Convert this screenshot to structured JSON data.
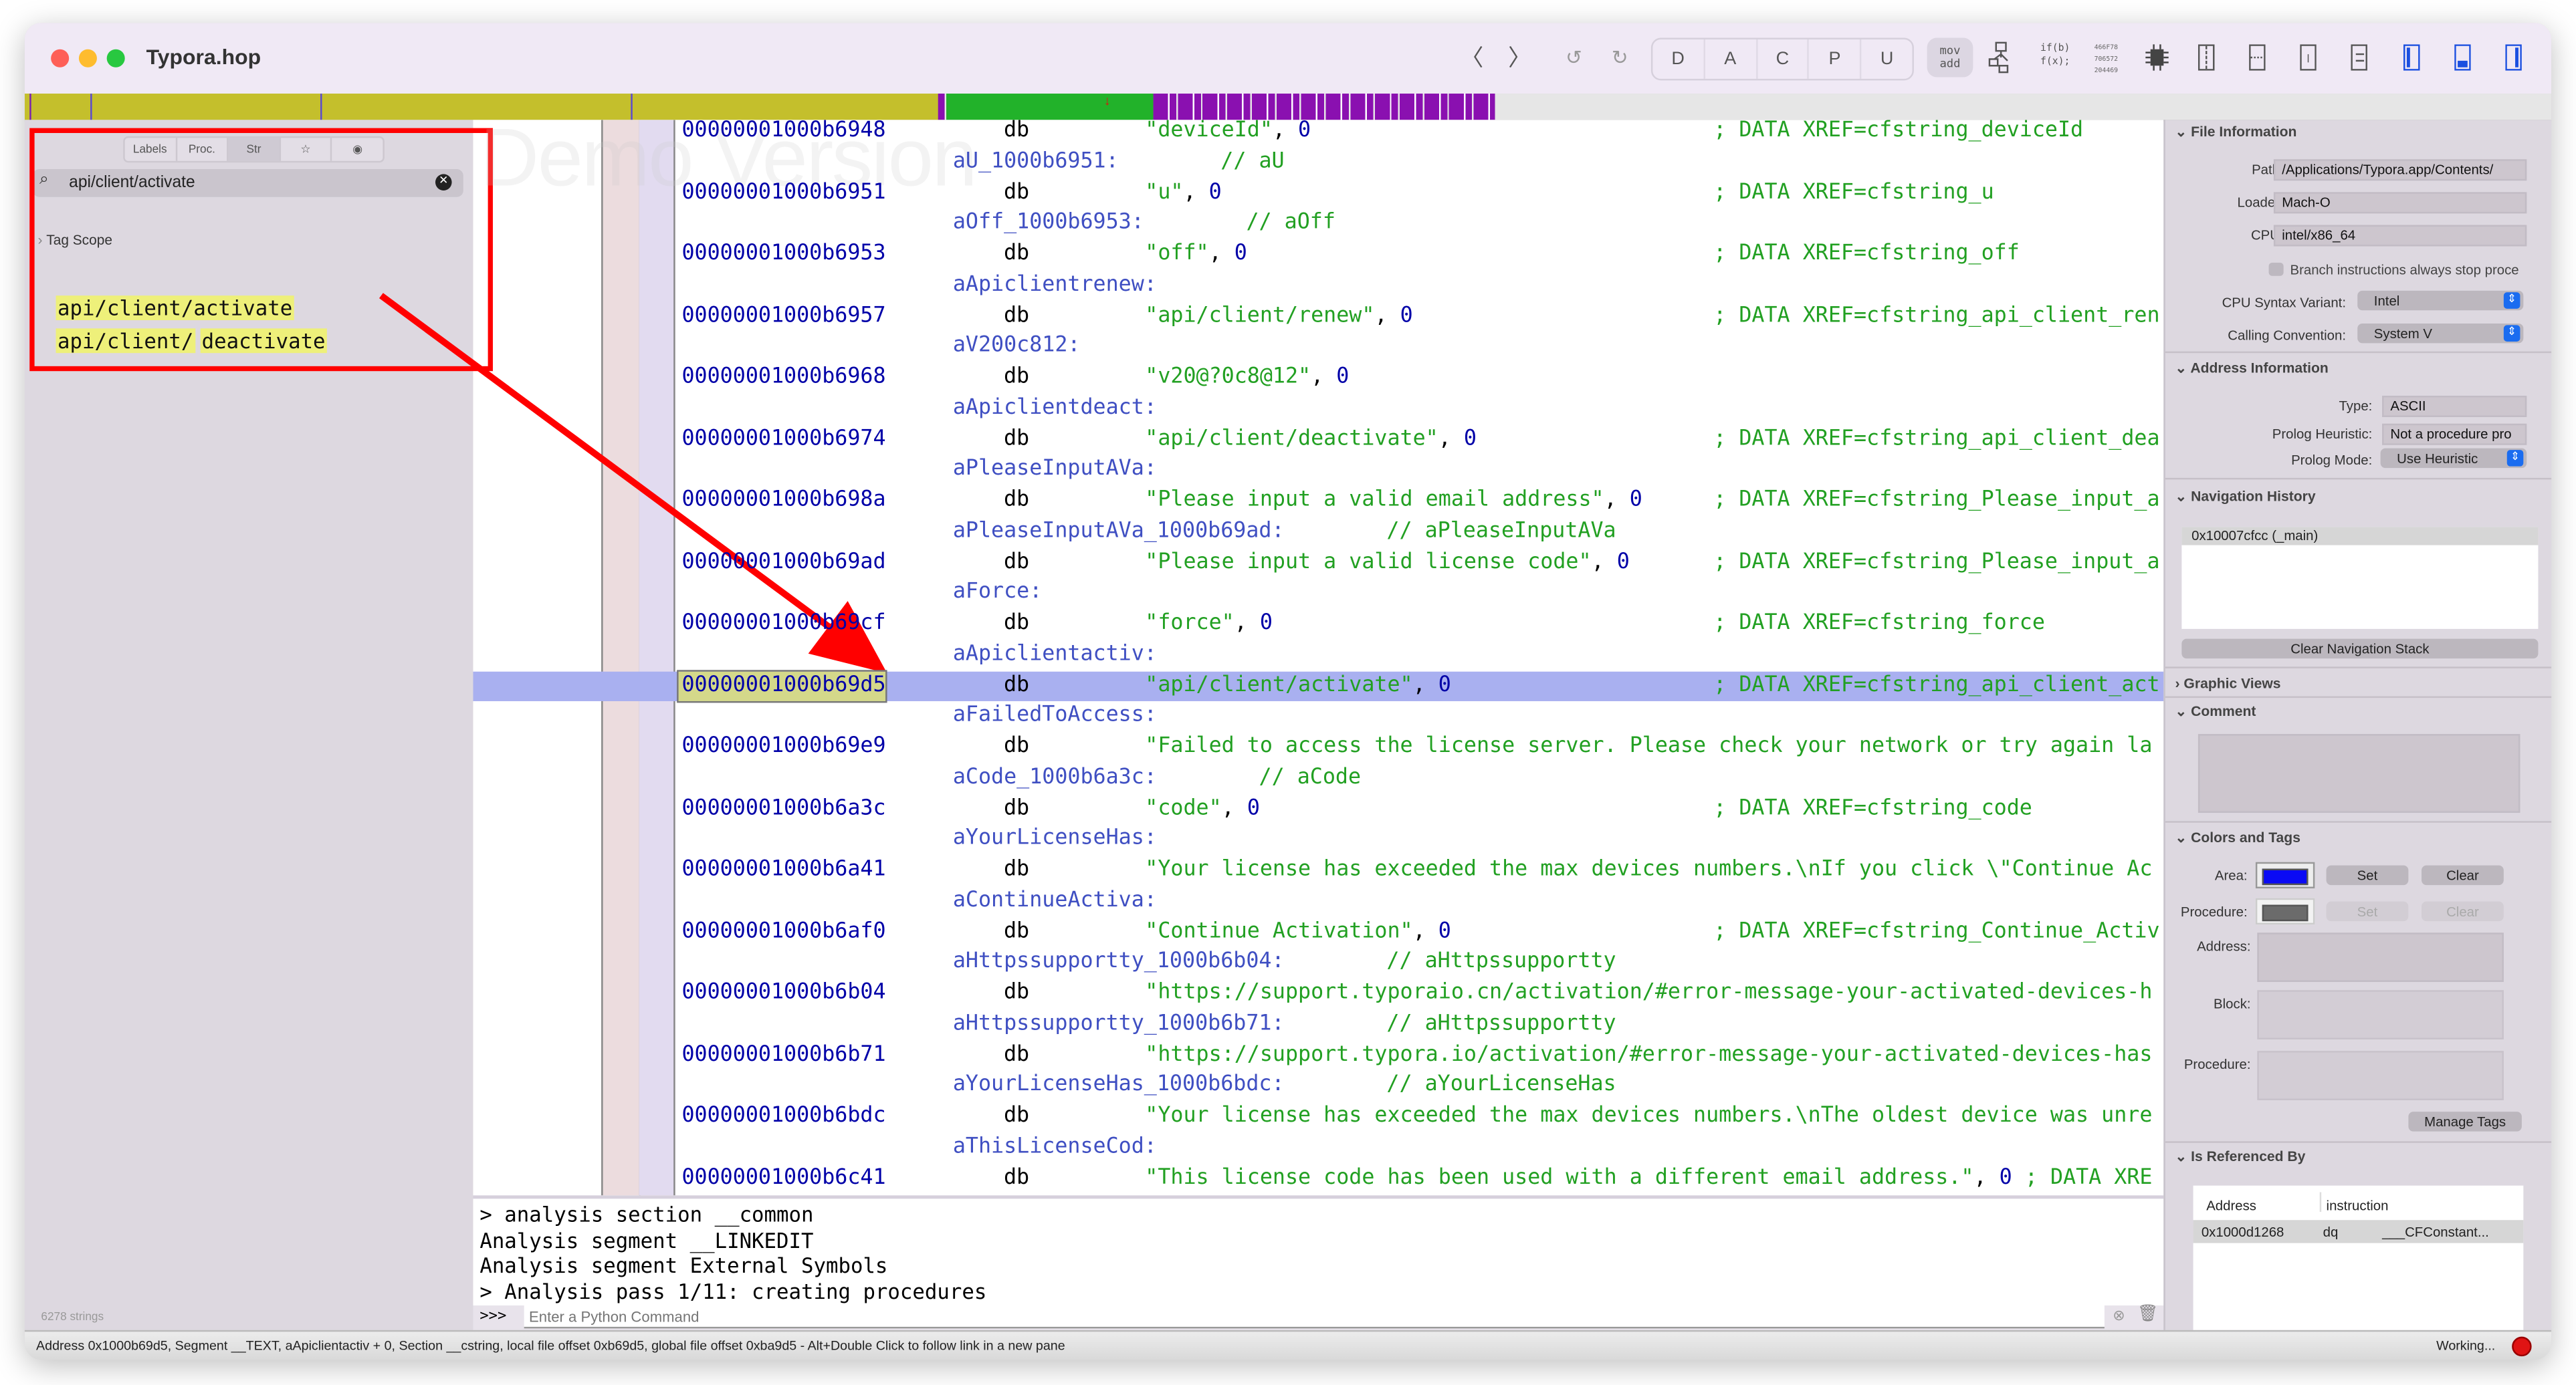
{
  "window": {
    "title": "Typora.hop",
    "watermark": "Demo Version"
  },
  "toolbar": {
    "back": "〈",
    "forward": "〉",
    "undo": "↺",
    "redo": "↻",
    "modes": [
      "D",
      "A",
      "C",
      "P",
      "U"
    ],
    "asm_top": "mov",
    "asm_bottom": "add",
    "pseudo_top": "if(b)",
    "pseudo_bottom": "f(x);",
    "hex_lines": [
      "466F78",
      "706572",
      "204469"
    ],
    "icons": [
      "flowchart-icon",
      "chip-icon",
      "split-vertical-icon",
      "split-horizontal-icon",
      "single-pane-icon",
      "swap-icon",
      "left-sidebar-icon",
      "bottom-panel-icon",
      "right-sidebar-icon"
    ]
  },
  "colors": {
    "accent": "#1a6cf0",
    "selection": "#a9b0f0",
    "highlight": "#eef07a",
    "annotation": "#ff0000",
    "segment_olive": "#c4bf2c",
    "segment_green": "#22b22a",
    "segment_purple": "#8a10b0"
  },
  "left": {
    "tabs": [
      "Labels",
      "Proc.",
      "Str",
      "☆",
      "◉"
    ],
    "search_value": "api/client/activate",
    "tag_scope": "Tag Scope",
    "results": [
      {
        "prefix": "api/client/activate",
        "suffix": ""
      },
      {
        "prefix": "api/client/",
        "suffix": "deactivate"
      }
    ],
    "count": "6278 strings"
  },
  "code": {
    "rows": [
      {
        "t": "i",
        "addr": "00000001000b6948",
        "mn": "db",
        "s": "\"deviceId\"",
        "n": "0",
        "cm": "; DATA XREF=cfstring_deviceId"
      },
      {
        "t": "l",
        "lbl": "aU_1000b6951:",
        "cm": "// aU"
      },
      {
        "t": "i",
        "addr": "00000001000b6951",
        "mn": "db",
        "s": "\"u\"",
        "n": "0",
        "cm": "; DATA XREF=cfstring_u"
      },
      {
        "t": "l",
        "lbl": "aOff_1000b6953:",
        "cm": "// aOff"
      },
      {
        "t": "i",
        "addr": "00000001000b6953",
        "mn": "db",
        "s": "\"off\"",
        "n": "0",
        "cm": "; DATA XREF=cfstring_off"
      },
      {
        "t": "l",
        "lbl": "aApiclientrenew:"
      },
      {
        "t": "i",
        "addr": "00000001000b6957",
        "mn": "db",
        "s": "\"api/client/renew\"",
        "n": "0",
        "cm": "; DATA XREF=cfstring_api_client_ren"
      },
      {
        "t": "l",
        "lbl": "aV200c812:"
      },
      {
        "t": "i",
        "addr": "00000001000b6968",
        "mn": "db",
        "s": "\"v20@?0c8@12\"",
        "n": "0"
      },
      {
        "t": "l",
        "lbl": "aApiclientdeact:"
      },
      {
        "t": "i",
        "addr": "00000001000b6974",
        "mn": "db",
        "s": "\"api/client/deactivate\"",
        "n": "0",
        "cm": "; DATA XREF=cfstring_api_client_dea"
      },
      {
        "t": "l",
        "lbl": "aPleaseInputAVa:"
      },
      {
        "t": "i",
        "addr": "00000001000b698a",
        "mn": "db",
        "s": "\"Please input a valid email address\"",
        "n": "0",
        "cm": "; DATA XREF=cfstring_Please_input_a"
      },
      {
        "t": "l",
        "lbl": "aPleaseInputAVa_1000b69ad:",
        "cm": "// aPleaseInputAVa"
      },
      {
        "t": "i",
        "addr": "00000001000b69ad",
        "mn": "db",
        "s": "\"Please input a valid license code\"",
        "n": "0",
        "cm": "; DATA XREF=cfstring_Please_input_a"
      },
      {
        "t": "l",
        "lbl": "aForce:"
      },
      {
        "t": "i",
        "addr": "00000001000b69cf",
        "mn": "db",
        "s": "\"force\"",
        "n": "0",
        "cm": "; DATA XREF=cfstring_force"
      },
      {
        "t": "l",
        "lbl": "aApiclientactiv:"
      },
      {
        "t": "i",
        "sel": true,
        "addr": "00000001000b69d5",
        "mn": "db",
        "s": "\"api/client/activate\"",
        "n": "0",
        "cm": "; DATA XREF=cfstring_api_client_act"
      },
      {
        "t": "l",
        "lbl": "aFailedToAccess:"
      },
      {
        "t": "i",
        "addr": "00000001000b69e9",
        "mn": "db",
        "s": "\"Failed to access the license server. Please check your network or try again la"
      },
      {
        "t": "l",
        "lbl": "aCode_1000b6a3c:",
        "cm": "// aCode"
      },
      {
        "t": "i",
        "addr": "00000001000b6a3c",
        "mn": "db",
        "s": "\"code\"",
        "n": "0",
        "cm": "; DATA XREF=cfstring_code"
      },
      {
        "t": "l",
        "lbl": "aYourLicenseHas:"
      },
      {
        "t": "i",
        "addr": "00000001000b6a41",
        "mn": "db",
        "s": "\"Your license has exceeded the max devices numbers.\\nIf you click \\\"Continue Ac"
      },
      {
        "t": "l",
        "lbl": "aContinueActiva:"
      },
      {
        "t": "i",
        "addr": "00000001000b6af0",
        "mn": "db",
        "s": "\"Continue Activation\"",
        "n": "0",
        "cm": "; DATA XREF=cfstring_Continue_Activ"
      },
      {
        "t": "l",
        "lbl": "aHttpssupportty_1000b6b04:",
        "cm": "// aHttpssupportty"
      },
      {
        "t": "i",
        "addr": "00000001000b6b04",
        "mn": "db",
        "s": "\"https://support.typoraio.cn/activation/#error-message-your-activated-devices-h"
      },
      {
        "t": "l",
        "lbl": "aHttpssupportty_1000b6b71:",
        "cm": "// aHttpssupportty"
      },
      {
        "t": "i",
        "addr": "00000001000b6b71",
        "mn": "db",
        "s": "\"https://support.typora.io/activation/#error-message-your-activated-devices-has"
      },
      {
        "t": "l",
        "lbl": "aYourLicenseHas_1000b6bdc:",
        "cm": "// aYourLicenseHas"
      },
      {
        "t": "i",
        "addr": "00000001000b6bdc",
        "mn": "db",
        "s": "\"Your license has exceeded the max devices numbers.\\nThe oldest device was unre"
      },
      {
        "t": "l",
        "lbl": "aThisLicenseCod:"
      },
      {
        "t": "i",
        "addr": "00000001000b6c41",
        "mn": "db",
        "s": "\"This license code has been used with a different email address.\"",
        "n": "0",
        "cm": "; DATA XRE",
        "inline": true
      }
    ]
  },
  "console": {
    "lines": [
      "> analysis section __common",
      "Analysis segment __LINKEDIT",
      "Analysis segment External Symbols",
      "> Analysis pass 1/11: creating procedures"
    ],
    "prompt": ">>>",
    "placeholder": "Enter a Python Command"
  },
  "status": {
    "text": "Address 0x1000b69d5, Segment __TEXT, aApiclientactiv + 0, Section __cstring, local file offset 0xb69d5, global file offset 0xba9d5 - Alt+Double Click to follow link in a new pane",
    "working": "Working..."
  },
  "inspector": {
    "file_info": {
      "title": "File Information",
      "path_label": "Path:",
      "path": "/Applications/Typora.app/Contents/",
      "loader_label": "Loader:",
      "loader": "Mach-O",
      "cpu_label": "CPU:",
      "cpu": "intel/x86_64",
      "branch_label": "Branch instructions always stop proce",
      "syntax_label": "CPU Syntax Variant:",
      "syntax": "Intel",
      "callconv_label": "Calling Convention:",
      "callconv": "System V"
    },
    "address_info": {
      "title": "Address Information",
      "type_label": "Type:",
      "type": "ASCII",
      "heur_label": "Prolog Heuristic:",
      "heur": "Not a procedure pro",
      "mode_label": "Prolog Mode:",
      "mode": "Use Heuristic"
    },
    "nav": {
      "title": "Navigation History",
      "items": [
        "0x10007cfcc (_main)"
      ],
      "clear": "Clear Navigation Stack"
    },
    "graphic": {
      "title": "Graphic Views"
    },
    "comment": {
      "title": "Comment"
    },
    "tags": {
      "title": "Colors and Tags",
      "area_label": "Area:",
      "area_color": "#0a0af5",
      "proc_label": "Procedure:",
      "proc_color": "#6b6b6b",
      "set": "Set",
      "clear": "Clear",
      "address_label": "Address:",
      "block_label": "Block:",
      "procedure_label": "Procedure:",
      "manage": "Manage Tags"
    },
    "refs": {
      "title": "Is Referenced By",
      "headers": [
        "Address",
        "instruction"
      ],
      "rows": [
        {
          "addr": "0x1000d1268",
          "mn": "dq",
          "arg": "___CFConstant..."
        }
      ]
    }
  }
}
